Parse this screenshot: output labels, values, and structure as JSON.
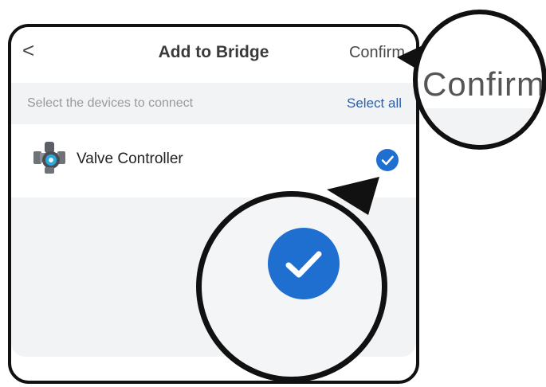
{
  "header": {
    "back_glyph": "<",
    "title": "Add to Bridge",
    "confirm_label": "Confirm"
  },
  "subbar": {
    "hint": "Select the devices to connect",
    "select_all": "Select all"
  },
  "devices": [
    {
      "name": "Valve Controller",
      "icon": "valve-icon",
      "checked": true
    }
  ],
  "callouts": {
    "confirm_zoom_text": "Confirm"
  },
  "colors": {
    "accent": "#1f6fd1",
    "link": "#2f5fa8",
    "background_gray": "#f2f3f5",
    "outline": "#111111"
  }
}
